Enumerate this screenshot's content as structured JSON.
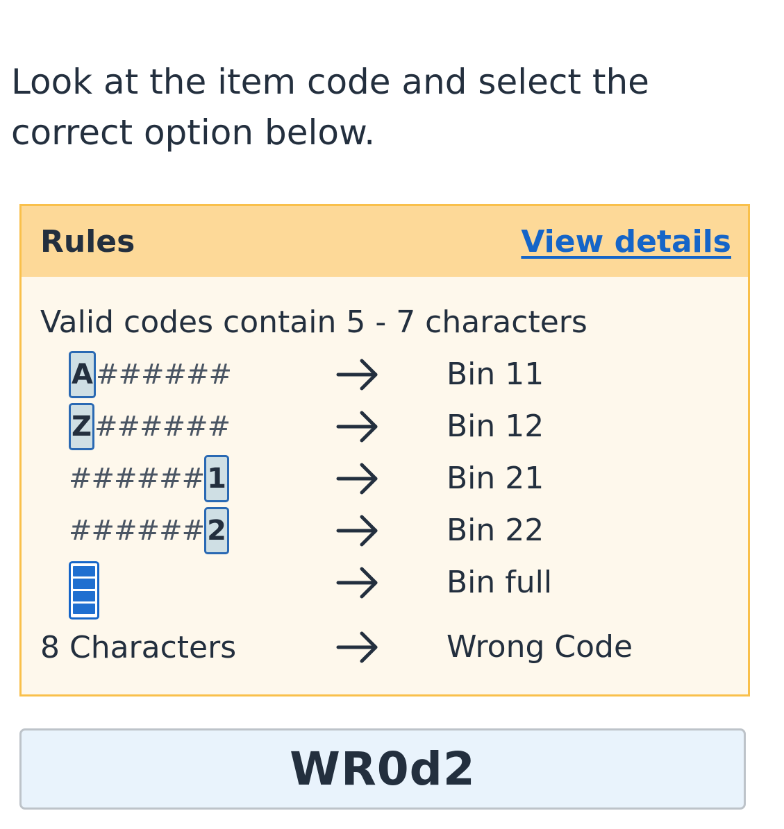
{
  "instruction": "Look at the item code and select the correct option below.",
  "rules": {
    "title": "Rules",
    "view_details_link": "View details",
    "intro": "Valid codes contain 5 - 7 characters",
    "rows": [
      {
        "prefix": "A",
        "hashes": "######",
        "suffix": "",
        "arrow": "→",
        "result": "Bin 11"
      },
      {
        "prefix": "Z",
        "hashes": "######",
        "suffix": "",
        "arrow": "→",
        "result": "Bin 12"
      },
      {
        "prefix": "",
        "hashes": "######",
        "suffix": "1",
        "arrow": "→",
        "result": "Bin 21"
      },
      {
        "prefix": "",
        "hashes": "######",
        "suffix": "2",
        "arrow": "→",
        "result": "Bin 22"
      },
      {
        "icon": "full-bin-icon",
        "arrow": "→",
        "result": "Bin full"
      },
      {
        "label": "8 Characters",
        "arrow": "→",
        "result": "Wrong Code"
      }
    ]
  },
  "item_code": "WR0d2",
  "colors": {
    "text": "#232f3e",
    "link": "#1565c8",
    "rules_header_bg": "#fdd998",
    "rules_body_bg": "#fef8ec",
    "rules_border": "#f9c04b",
    "highlight_border": "#2a69b3",
    "highlight_bg": "#cfdfe4",
    "code_card_bg": "#e9f3fc",
    "code_card_border": "#bdc3c9"
  }
}
